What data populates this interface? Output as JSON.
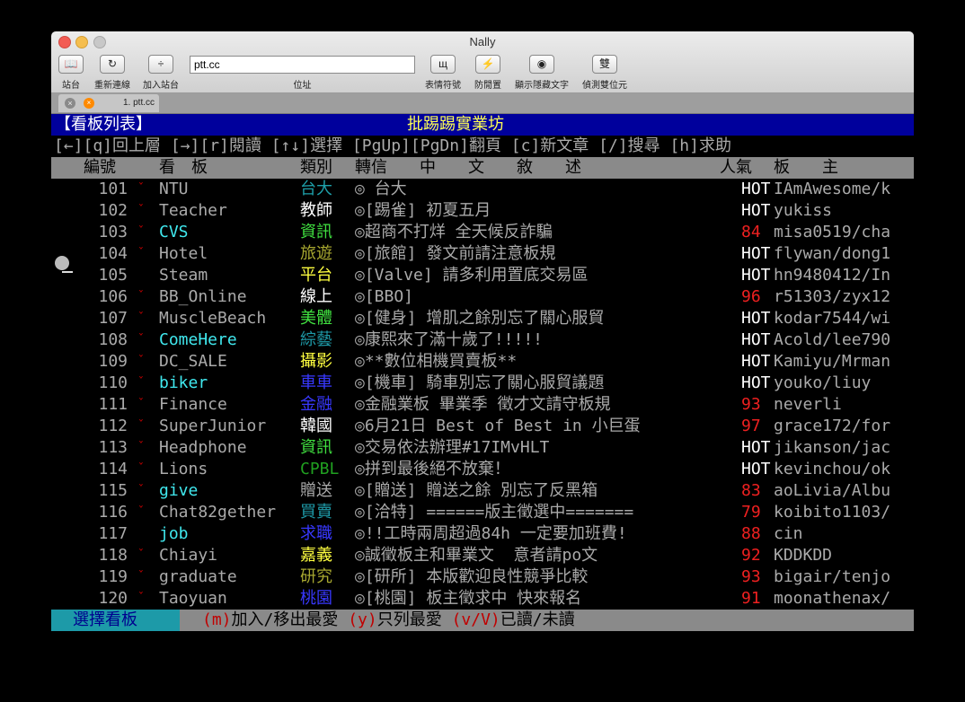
{
  "window": {
    "title": "Nally"
  },
  "toolbar": {
    "sites": {
      "icon": "book-icon",
      "label": "站台"
    },
    "reconnect": {
      "icon": "reload-icon",
      "label": "重新連線"
    },
    "add_site": {
      "icon": "add-icon",
      "label": "加入站台"
    },
    "address": {
      "value": "ptt.cc",
      "label": "位址"
    },
    "emoticons": {
      "icon": "emoticon-icon",
      "label": "表情符號"
    },
    "anti_idle": {
      "icon": "anti-idle-icon",
      "label": "防閒置"
    },
    "show_hidden": {
      "icon": "eye-icon",
      "label": "顯示隱藏文字"
    },
    "detect_double": {
      "icon": "double-byte-icon",
      "label": "偵測雙位元"
    }
  },
  "tab": {
    "label": "1. ptt.cc"
  },
  "terminal": {
    "header_left": "【看板列表】",
    "header_center": "批踢踢實業坊",
    "help_line": "[←][q]回上層 [→][r]閱讀 [↑↓]選擇 [PgUp][PgDn]翻頁 [c]新文章 [/]搜尋 [h]求助",
    "col_num": "編號",
    "col_board": "看　板",
    "col_class": "類別",
    "col_relay": "轉信",
    "col_desc": "中　　文　　敘　　述",
    "col_pop": "人氣",
    "col_mod": "板　　主",
    "boards": [
      {
        "num": "101",
        "mark": "ˇ",
        "name": "NTU",
        "name_color": "#aaaaaa",
        "cls": "台大",
        "cls_color": "#1ea0aa",
        "title": "◎ 台大",
        "pop": "HOT",
        "pop_color": "#ffffff",
        "mod": "IAmAwesome/k"
      },
      {
        "num": "102",
        "mark": "ˇ",
        "name": "Teacher",
        "name_color": "#aaaaaa",
        "cls": "教師",
        "cls_color": "#ffffff",
        "title": "◎[踢雀] 初夏五月",
        "pop": "HOT",
        "pop_color": "#ffffff",
        "mod": "yukiss"
      },
      {
        "num": "103",
        "mark": "ˇ",
        "name": "CVS",
        "name_color": "#40e8ee",
        "cls": "資訊",
        "cls_color": "#40e040",
        "title": "◎超商不打烊 全天候反詐騙",
        "pop": "84",
        "pop_color": "#ee2020",
        "mod": "misa0519/cha"
      },
      {
        "num": "104",
        "mark": "ˇ",
        "name": "Hotel",
        "name_color": "#aaaaaa",
        "cls": "旅遊",
        "cls_color": "#a8a830",
        "title": "◎[旅館] 發文前請注意板規",
        "pop": "HOT",
        "pop_color": "#ffffff",
        "mod": "flywan/dong1"
      },
      {
        "num": "105",
        "mark": "",
        "name": "Steam",
        "name_color": "#aaaaaa",
        "cls": "平台",
        "cls_color": "#ffff40",
        "title": "◎[Valve] 請多利用置底交易區",
        "pop": "HOT",
        "pop_color": "#ffffff",
        "mod": "hn9480412/In"
      },
      {
        "num": "106",
        "mark": "ˇ",
        "name": "BB_Online",
        "name_color": "#aaaaaa",
        "cls": "線上",
        "cls_color": "#ffffff",
        "title": "◎[BBO]",
        "pop": "96",
        "pop_color": "#ee2020",
        "mod": "r51303/zyx12"
      },
      {
        "num": "107",
        "mark": "ˇ",
        "name": "MuscleBeach",
        "name_color": "#aaaaaa",
        "cls": "美體",
        "cls_color": "#40e040",
        "title": "◎[健身] 增肌之餘別忘了關心服貿",
        "pop": "HOT",
        "pop_color": "#ffffff",
        "mod": "kodar7544/wi"
      },
      {
        "num": "108",
        "mark": "ˇ",
        "name": "ComeHere",
        "name_color": "#40e8ee",
        "cls": "綜藝",
        "cls_color": "#1e9aa8",
        "title": "◎康熙來了滿十歲了!!!!!",
        "pop": "HOT",
        "pop_color": "#ffffff",
        "mod": "Acold/lee790"
      },
      {
        "num": "109",
        "mark": "ˇ",
        "name": "DC_SALE",
        "name_color": "#aaaaaa",
        "cls": "攝影",
        "cls_color": "#ffff40",
        "title": "◎**數位相機買賣板**",
        "pop": "HOT",
        "pop_color": "#ffffff",
        "mod": "Kamiyu/Mrman"
      },
      {
        "num": "110",
        "mark": "ˇ",
        "name": "biker",
        "name_color": "#40e8ee",
        "cls": "車車",
        "cls_color": "#3838ff",
        "title": "◎[機車] 騎車別忘了關心服貿議題",
        "pop": "HOT",
        "pop_color": "#ffffff",
        "mod": "youko/liuy"
      },
      {
        "num": "111",
        "mark": "ˇ",
        "name": "Finance",
        "name_color": "#aaaaaa",
        "cls": "金融",
        "cls_color": "#3838ff",
        "title": "◎金融業板 畢業季 徵才文請守板規",
        "pop": "93",
        "pop_color": "#ee2020",
        "mod": "neverli"
      },
      {
        "num": "112",
        "mark": "ˇ",
        "name": "SuperJunior",
        "name_color": "#aaaaaa",
        "cls": "韓國",
        "cls_color": "#ffffff",
        "title": "◎6月21日 Best of Best in 小巨蛋",
        "pop": "97",
        "pop_color": "#ee2020",
        "mod": "grace172/for"
      },
      {
        "num": "113",
        "mark": "ˇ",
        "name": "Headphone",
        "name_color": "#aaaaaa",
        "cls": "資訊",
        "cls_color": "#40e040",
        "title": "◎交易依法辦理#17IMvHLT",
        "pop": "HOT",
        "pop_color": "#ffffff",
        "mod": "jikanson/jac"
      },
      {
        "num": "114",
        "mark": "ˇ",
        "name": "Lions",
        "name_color": "#aaaaaa",
        "cls": "CPBL",
        "cls_color": "#20a020",
        "title": "◎拼到最後絕不放棄！",
        "pop": "HOT",
        "pop_color": "#ffffff",
        "mod": "kevinchou/ok"
      },
      {
        "num": "115",
        "mark": "ˇ",
        "name": "give",
        "name_color": "#40e8ee",
        "cls": "贈送",
        "cls_color": "#aaaaaa",
        "title": "◎[贈送] 贈送之餘 別忘了反黑箱",
        "pop": "83",
        "pop_color": "#ee2020",
        "mod": "aoLivia/Albu"
      },
      {
        "num": "116",
        "mark": "ˇ",
        "name": "Chat82gether",
        "name_color": "#aaaaaa",
        "cls": "買賣",
        "cls_color": "#1e9aa8",
        "title": "◎[洽特] ======版主徵選中=======",
        "pop": "79",
        "pop_color": "#ee2020",
        "mod": "koibito1103/"
      },
      {
        "num": "117",
        "mark": "",
        "name": "job",
        "name_color": "#40e8ee",
        "cls": "求職",
        "cls_color": "#3838ff",
        "title": "◎!!工時兩周超過84h 一定要加班費!",
        "pop": "88",
        "pop_color": "#ee2020",
        "mod": "cin"
      },
      {
        "num": "118",
        "mark": "ˇ",
        "name": "Chiayi",
        "name_color": "#aaaaaa",
        "cls": "嘉義",
        "cls_color": "#ffff40",
        "title": "◎誠徵板主和畢業文  意者請po文",
        "pop": "92",
        "pop_color": "#ee2020",
        "mod": "KDDKDD"
      },
      {
        "num": "119",
        "mark": "ˇ",
        "name": "graduate",
        "name_color": "#aaaaaa",
        "cls": "研究",
        "cls_color": "#a8a830",
        "title": "◎[研所] 本版歡迎良性競爭比較",
        "pop": "93",
        "pop_color": "#ee2020",
        "mod": "bigair/tenjo"
      },
      {
        "num": "120",
        "mark": "ˇ",
        "name": "Taoyuan",
        "name_color": "#aaaaaa",
        "cls": "桃園",
        "cls_color": "#3838ff",
        "title": "◎[桃園] 板主徵求中 快來報名",
        "pop": "91",
        "pop_color": "#ee2020",
        "mod": "moonathenax/"
      }
    ],
    "footer_select": "選擇看板",
    "footer_k1": "(m)",
    "footer_v1": "加入/移出最愛",
    "footer_k2": "(y)",
    "footer_v2": "只列最愛",
    "footer_k3": "(v/V)",
    "footer_v3": "已讀/未讀",
    "key_color": "#c00000"
  }
}
